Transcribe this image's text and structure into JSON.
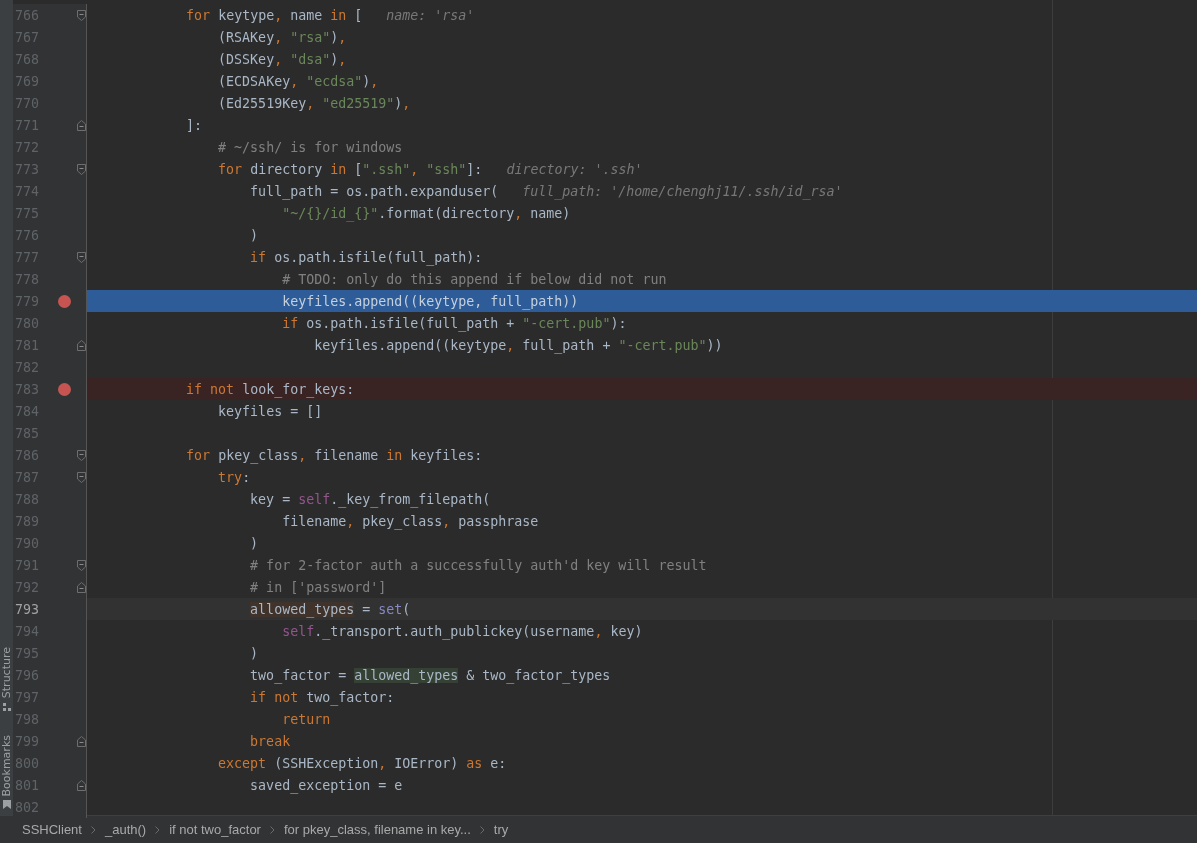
{
  "tool_strip": {
    "labels": [
      {
        "text": "Structure"
      },
      {
        "text": "Bookmarks"
      }
    ]
  },
  "lines": [
    {
      "number": "766",
      "breakpoint": false,
      "current": false,
      "caret": false,
      "fold_start": true,
      "fold_end": false,
      "tokens": [
        {
          "kind": "keyword",
          "text": "            for"
        },
        {
          "kind": "plain",
          "text": " keytype"
        },
        {
          "kind": "punct",
          "text": ","
        },
        {
          "kind": "plain",
          "text": " name "
        },
        {
          "kind": "keyword",
          "text": "in"
        },
        {
          "kind": "plain",
          "text": " ["
        }
      ],
      "hint": "name: 'rsa'"
    },
    {
      "number": "767",
      "breakpoint": false,
      "current": false,
      "caret": false,
      "fold_start": false,
      "fold_end": false,
      "tokens": [
        {
          "kind": "plain",
          "text": "                (RSAKey"
        },
        {
          "kind": "punct",
          "text": ","
        },
        {
          "kind": "string",
          "text": " \"rsa\""
        },
        {
          "kind": "plain",
          "text": ")"
        },
        {
          "kind": "punct",
          "text": ","
        }
      ]
    },
    {
      "number": "768",
      "breakpoint": false,
      "current": false,
      "caret": false,
      "fold_start": false,
      "fold_end": false,
      "tokens": [
        {
          "kind": "plain",
          "text": "                (DSSKey"
        },
        {
          "kind": "punct",
          "text": ","
        },
        {
          "kind": "string",
          "text": " \"dsa\""
        },
        {
          "kind": "plain",
          "text": ")"
        },
        {
          "kind": "punct",
          "text": ","
        }
      ]
    },
    {
      "number": "769",
      "breakpoint": false,
      "current": false,
      "caret": false,
      "fold_start": false,
      "fold_end": false,
      "tokens": [
        {
          "kind": "plain",
          "text": "                (ECDSAKey"
        },
        {
          "kind": "punct",
          "text": ","
        },
        {
          "kind": "string",
          "text": " \"ecdsa\""
        },
        {
          "kind": "plain",
          "text": ")"
        },
        {
          "kind": "punct",
          "text": ","
        }
      ]
    },
    {
      "number": "770",
      "breakpoint": false,
      "current": false,
      "caret": false,
      "fold_start": false,
      "fold_end": false,
      "tokens": [
        {
          "kind": "plain",
          "text": "                (Ed25519Key"
        },
        {
          "kind": "punct",
          "text": ","
        },
        {
          "kind": "string",
          "text": " \"ed25519\""
        },
        {
          "kind": "plain",
          "text": ")"
        },
        {
          "kind": "punct",
          "text": ","
        }
      ]
    },
    {
      "number": "771",
      "breakpoint": false,
      "current": false,
      "caret": false,
      "fold_start": false,
      "fold_end": true,
      "tokens": [
        {
          "kind": "plain",
          "text": "            ]:"
        }
      ]
    },
    {
      "number": "772",
      "breakpoint": false,
      "current": false,
      "caret": false,
      "fold_start": false,
      "fold_end": false,
      "tokens": [
        {
          "kind": "comment",
          "text": "                # ~/ssh/ is for windows"
        }
      ]
    },
    {
      "number": "773",
      "breakpoint": false,
      "current": false,
      "caret": false,
      "fold_start": true,
      "fold_end": false,
      "tokens": [
        {
          "kind": "keyword",
          "text": "                for"
        },
        {
          "kind": "plain",
          "text": " directory "
        },
        {
          "kind": "keyword",
          "text": "in"
        },
        {
          "kind": "plain",
          "text": " ["
        },
        {
          "kind": "string",
          "text": "\".ssh\""
        },
        {
          "kind": "punct",
          "text": ","
        },
        {
          "kind": "string",
          "text": " \"ssh\""
        },
        {
          "kind": "plain",
          "text": "]:"
        }
      ],
      "hint": "directory: '.ssh'"
    },
    {
      "number": "774",
      "breakpoint": false,
      "current": false,
      "caret": false,
      "fold_start": false,
      "fold_end": false,
      "tokens": [
        {
          "kind": "plain",
          "text": "                    full_path = os.path.expanduser("
        }
      ],
      "hint": "full_path: '/home/chenghj11/.ssh/id_rsa'"
    },
    {
      "number": "775",
      "breakpoint": false,
      "current": false,
      "caret": false,
      "fold_start": false,
      "fold_end": false,
      "tokens": [
        {
          "kind": "string",
          "text": "                        \"~/{}/id_{}\""
        },
        {
          "kind": "plain",
          "text": ".format(directory"
        },
        {
          "kind": "punct",
          "text": ","
        },
        {
          "kind": "plain",
          "text": " name)"
        }
      ]
    },
    {
      "number": "776",
      "breakpoint": false,
      "current": false,
      "caret": false,
      "fold_start": false,
      "fold_end": false,
      "tokens": [
        {
          "kind": "plain",
          "text": "                    )"
        }
      ]
    },
    {
      "number": "777",
      "breakpoint": false,
      "current": false,
      "caret": false,
      "fold_start": true,
      "fold_end": false,
      "tokens": [
        {
          "kind": "keyword",
          "text": "                    if"
        },
        {
          "kind": "plain",
          "text": " os.path.isfile(full_path):"
        }
      ]
    },
    {
      "number": "778",
      "breakpoint": false,
      "current": false,
      "caret": false,
      "fold_start": false,
      "fold_end": false,
      "tokens": [
        {
          "kind": "comment",
          "text": "                        # TODO: only do this append if below did not run"
        }
      ]
    },
    {
      "number": "779",
      "breakpoint": true,
      "current": true,
      "caret": false,
      "fold_start": false,
      "fold_end": false,
      "tokens": [
        {
          "kind": "plain",
          "text": "                        keyfiles.append((keytype"
        },
        {
          "kind": "punct",
          "text": ","
        },
        {
          "kind": "plain",
          "text": " full_path))"
        }
      ]
    },
    {
      "number": "780",
      "breakpoint": false,
      "current": false,
      "caret": false,
      "fold_start": false,
      "fold_end": false,
      "tokens": [
        {
          "kind": "keyword",
          "text": "                        if"
        },
        {
          "kind": "plain",
          "text": " os.path.isfile(full_path + "
        },
        {
          "kind": "string",
          "text": "\"-cert.pub\""
        },
        {
          "kind": "plain",
          "text": "):"
        }
      ]
    },
    {
      "number": "781",
      "breakpoint": false,
      "current": false,
      "caret": false,
      "fold_start": false,
      "fold_end": true,
      "tokens": [
        {
          "kind": "plain",
          "text": "                            keyfiles.append((keytype"
        },
        {
          "kind": "punct",
          "text": ","
        },
        {
          "kind": "plain",
          "text": " full_path + "
        },
        {
          "kind": "string",
          "text": "\"-cert.pub\""
        },
        {
          "kind": "plain",
          "text": "))"
        }
      ]
    },
    {
      "number": "782",
      "breakpoint": false,
      "current": false,
      "caret": false,
      "fold_start": false,
      "fold_end": false
    },
    {
      "number": "783",
      "breakpoint": true,
      "current": false,
      "caret": false,
      "fold_start": false,
      "fold_end": false,
      "tokens": [
        {
          "kind": "keyword",
          "text": "            if not"
        },
        {
          "kind": "plain",
          "text": " look_for_keys:"
        }
      ]
    },
    {
      "number": "784",
      "breakpoint": false,
      "current": false,
      "caret": false,
      "fold_start": false,
      "fold_end": false,
      "tokens": [
        {
          "kind": "plain",
          "text": "                keyfiles = []"
        }
      ]
    },
    {
      "number": "785",
      "breakpoint": false,
      "current": false,
      "caret": false,
      "fold_start": false,
      "fold_end": false
    },
    {
      "number": "786",
      "breakpoint": false,
      "current": false,
      "caret": false,
      "fold_start": true,
      "fold_end": false,
      "tokens": [
        {
          "kind": "keyword",
          "text": "            for"
        },
        {
          "kind": "plain",
          "text": " pkey_class"
        },
        {
          "kind": "punct",
          "text": ","
        },
        {
          "kind": "plain",
          "text": " filename "
        },
        {
          "kind": "keyword",
          "text": "in"
        },
        {
          "kind": "plain",
          "text": " keyfiles:"
        }
      ]
    },
    {
      "number": "787",
      "breakpoint": false,
      "current": false,
      "caret": false,
      "fold_start": true,
      "fold_end": false,
      "tokens": [
        {
          "kind": "keyword",
          "text": "                try"
        },
        {
          "kind": "plain",
          "text": ":"
        }
      ]
    },
    {
      "number": "788",
      "breakpoint": false,
      "current": false,
      "caret": false,
      "fold_start": false,
      "fold_end": false,
      "tokens": [
        {
          "kind": "plain",
          "text": "                    key = "
        },
        {
          "kind": "self",
          "text": "self"
        },
        {
          "kind": "plain",
          "text": "._key_from_filepath("
        }
      ]
    },
    {
      "number": "789",
      "breakpoint": false,
      "current": false,
      "caret": false,
      "fold_start": false,
      "fold_end": false,
      "tokens": [
        {
          "kind": "plain",
          "text": "                        filename"
        },
        {
          "kind": "punct",
          "text": ","
        },
        {
          "kind": "plain",
          "text": " pkey_class"
        },
        {
          "kind": "punct",
          "text": ","
        },
        {
          "kind": "plain",
          "text": " passphrase"
        }
      ]
    },
    {
      "number": "790",
      "breakpoint": false,
      "current": false,
      "caret": false,
      "fold_start": false,
      "fold_end": false,
      "tokens": [
        {
          "kind": "plain",
          "text": "                    )"
        }
      ]
    },
    {
      "number": "791",
      "breakpoint": false,
      "current": false,
      "caret": false,
      "fold_start": true,
      "fold_end": false,
      "tokens": [
        {
          "kind": "comment",
          "text": "                    # for 2-factor auth a successfully auth'd key will result"
        }
      ]
    },
    {
      "number": "792",
      "breakpoint": false,
      "current": false,
      "caret": false,
      "fold_start": false,
      "fold_end": true,
      "tokens": [
        {
          "kind": "comment",
          "text": "                    # in ['password']"
        }
      ]
    },
    {
      "number": "793",
      "breakpoint": false,
      "current": false,
      "caret": true,
      "fold_start": false,
      "fold_end": false,
      "tokens": [
        {
          "kind": "write",
          "text": "                    allowed_types"
        },
        {
          "kind": "plain",
          "text": " = "
        },
        {
          "kind": "builtin",
          "text": "set"
        },
        {
          "kind": "plain",
          "text": "("
        }
      ]
    },
    {
      "number": "794",
      "breakpoint": false,
      "current": false,
      "caret": false,
      "fold_start": false,
      "fold_end": false,
      "tokens": [
        {
          "kind": "self",
          "text": "                        self"
        },
        {
          "kind": "plain",
          "text": "._transport.auth_publickey(username"
        },
        {
          "kind": "punct",
          "text": ","
        },
        {
          "kind": "plain",
          "text": " key)"
        }
      ]
    },
    {
      "number": "795",
      "breakpoint": false,
      "current": false,
      "caret": false,
      "fold_start": false,
      "fold_end": false,
      "tokens": [
        {
          "kind": "plain",
          "text": "                    )"
        }
      ]
    },
    {
      "number": "796",
      "breakpoint": false,
      "current": false,
      "caret": false,
      "fold_start": false,
      "fold_end": false,
      "tokens": [
        {
          "kind": "plain",
          "text": "                    two_factor = "
        },
        {
          "kind": "read",
          "text": "allowed_types"
        },
        {
          "kind": "plain",
          "text": " & two_factor_types"
        }
      ]
    },
    {
      "number": "797",
      "breakpoint": false,
      "current": false,
      "caret": false,
      "fold_start": false,
      "fold_end": false,
      "tokens": [
        {
          "kind": "keyword",
          "text": "                    if not"
        },
        {
          "kind": "plain",
          "text": " two_factor:"
        }
      ]
    },
    {
      "number": "798",
      "breakpoint": false,
      "current": false,
      "caret": false,
      "fold_start": false,
      "fold_end": false,
      "tokens": [
        {
          "kind": "keyword",
          "text": "                        return"
        }
      ]
    },
    {
      "number": "799",
      "breakpoint": false,
      "current": false,
      "caret": false,
      "fold_start": false,
      "fold_end": true,
      "tokens": [
        {
          "kind": "keyword",
          "text": "                    break"
        }
      ]
    },
    {
      "number": "800",
      "breakpoint": false,
      "current": false,
      "caret": false,
      "fold_start": false,
      "fold_end": false,
      "tokens": [
        {
          "kind": "keyword",
          "text": "                except"
        },
        {
          "kind": "plain",
          "text": " (SSHException"
        },
        {
          "kind": "punct",
          "text": ","
        },
        {
          "kind": "plain",
          "text": " IOError) "
        },
        {
          "kind": "keyword",
          "text": "as"
        },
        {
          "kind": "plain",
          "text": " e:"
        }
      ]
    },
    {
      "number": "801",
      "breakpoint": false,
      "current": false,
      "caret": false,
      "fold_start": false,
      "fold_end": true,
      "tokens": [
        {
          "kind": "plain",
          "text": "                    saved_exception = e"
        }
      ]
    },
    {
      "number": "802",
      "breakpoint": false,
      "current": false,
      "caret": false,
      "fold_start": false,
      "fold_end": false
    }
  ],
  "breadcrumbs": [
    {
      "text": "SSHClient"
    },
    {
      "text": "_auth()"
    },
    {
      "text": "if not two_factor"
    },
    {
      "text": "for pkey_class, filename in key..."
    },
    {
      "text": "try"
    }
  ]
}
